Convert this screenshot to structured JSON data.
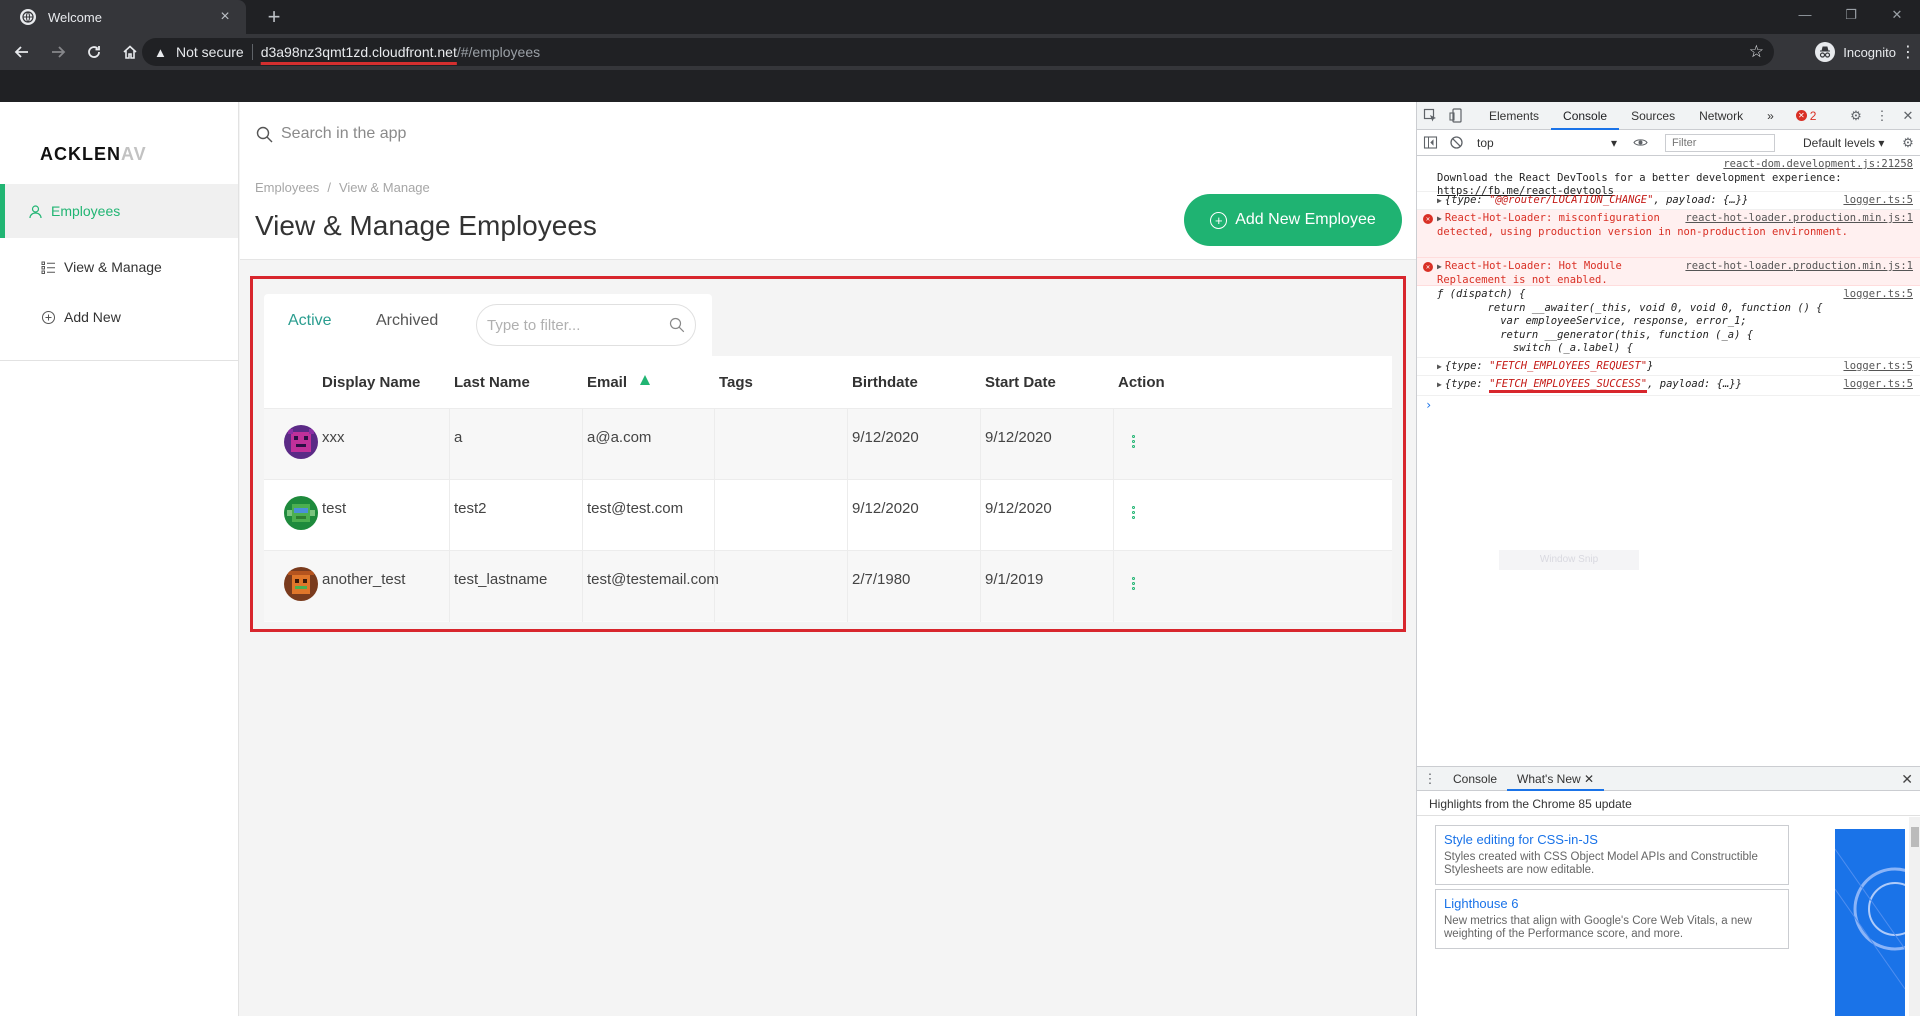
{
  "browser": {
    "tab_title": "Welcome",
    "tab_close": "×",
    "new_tab": "+",
    "security_label": "Not secure",
    "url_host": "d3a98nz3qmt1zd.cloudfront.net",
    "url_path": "/#/employees",
    "profile_label": "Incognito"
  },
  "app": {
    "logo_main": "ACKLEN",
    "logo_faded": "AV",
    "sidebar": {
      "items": [
        {
          "label": "Employees",
          "icon": "user-icon"
        },
        {
          "label": "View & Manage",
          "icon": "list-icon"
        },
        {
          "label": "Add New",
          "icon": "plus-circle-icon"
        }
      ]
    },
    "search_placeholder": "Search in the app",
    "breadcrumb": {
      "items": [
        "Employees",
        "View & Manage"
      ],
      "separator": "/"
    },
    "page_title": "View & Manage Employees",
    "add_button_label": "Add New Employee",
    "accent_color": "#21b573",
    "tabs": [
      "Active",
      "Archived"
    ],
    "filter_placeholder": "Type to filter...",
    "table": {
      "columns": [
        "Display Name",
        "Last Name",
        "Email",
        "Tags",
        "Birthdate",
        "Start Date",
        "Action"
      ],
      "sorted_column": "Email",
      "rows": [
        {
          "display_name": "xxx",
          "last_name": "a",
          "email": "a@a.com",
          "tags": "",
          "birthdate": "9/12/2020",
          "start_date": "9/12/2020"
        },
        {
          "display_name": "test",
          "last_name": "test2",
          "email": "test@test.com",
          "tags": "",
          "birthdate": "9/12/2020",
          "start_date": "9/12/2020"
        },
        {
          "display_name": "another_test",
          "last_name": "test_lastname",
          "email": "test@testemail.com",
          "tags": "",
          "birthdate": "2/7/1980",
          "start_date": "9/1/2019"
        }
      ]
    }
  },
  "devtools": {
    "tabs": [
      "Elements",
      "Console",
      "Sources",
      "Network"
    ],
    "active_tab": "Console",
    "more_tabs": "»",
    "error_count": "2",
    "context": "top",
    "filter_placeholder": "Filter",
    "levels": "Default levels ▾",
    "messages": [
      {
        "src": "react-dom.development.js:21258",
        "text": "Download the React DevTools for a better development experience: ",
        "link": "https://fb.me/react-devtools"
      },
      {
        "src": "logger.ts:5",
        "pre": "{type: ",
        "str": "\"@@router/LOCATION_CHANGE\"",
        "post": ", payload: {…}}"
      },
      {
        "src": "react-hot-loader.production.min.js:1",
        "text": "React-Hot-Loader: misconfiguration detected, using production version in non-production environment."
      },
      {
        "src": "react-hot-loader.production.min.js:1",
        "text": "React-Hot-Loader: Hot Module Replacement is not enabled."
      },
      {
        "src": "logger.ts:5",
        "code": "ƒ (dispatch) {\n        return __awaiter(_this, void 0, void 0, function () {\n          var employeeService, response, error_1;\n          return __generator(this, function (_a) {\n            switch (_a.label) {"
      },
      {
        "src": "logger.ts:5",
        "pre": "{type: ",
        "str": "\"FETCH_EMPLOYEES_REQUEST\"",
        "post": "}"
      },
      {
        "src": "logger.ts:5",
        "pre": "{type: ",
        "str": "\"FETCH_EMPLOYEES_SUCCESS\"",
        "post": ", payload: {…}}"
      }
    ],
    "prompt": "›",
    "snip_label": "Window Snip",
    "drawer": {
      "tabs": [
        "Console",
        "What's New"
      ],
      "active_tab": "What's New",
      "highlights": "Highlights from the Chrome 85 update",
      "news": [
        {
          "title": "Style editing for CSS-in-JS",
          "desc": "Styles created with CSS Object Model APIs and Constructible Stylesheets are now editable."
        },
        {
          "title": "Lighthouse 6",
          "desc": "New metrics that align with Google's Core Web Vitals, a new weighting of the Performance score, and more."
        }
      ]
    }
  }
}
